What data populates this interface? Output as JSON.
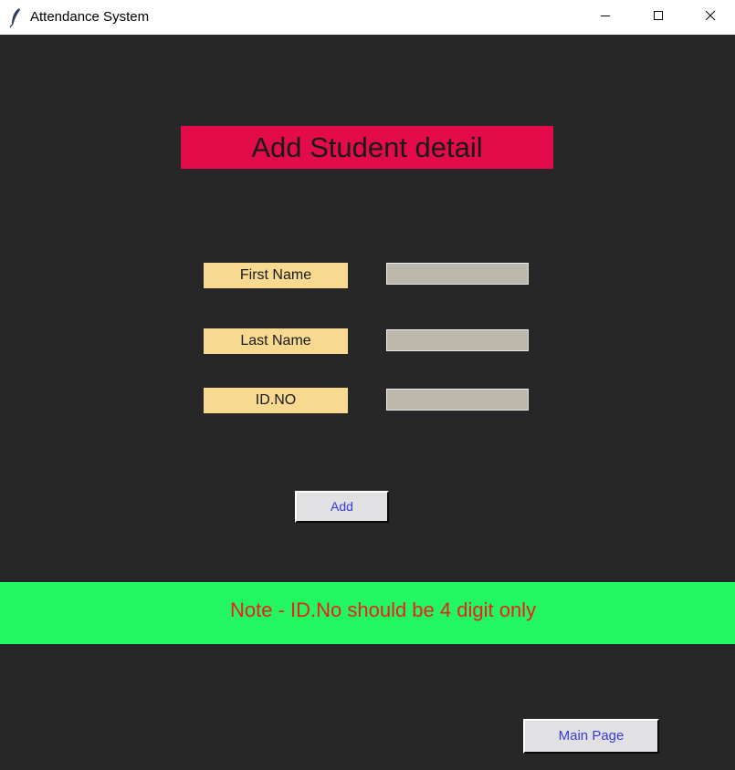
{
  "window": {
    "title": "Attendance System",
    "icons": {
      "app": "feather-icon",
      "minimize": "minimize-icon",
      "maximize": "maximize-icon",
      "close": "close-icon"
    }
  },
  "form": {
    "heading": "Add Student detail",
    "fields": [
      {
        "label": "First Name",
        "value": ""
      },
      {
        "label": "Last Name",
        "value": ""
      },
      {
        "label": "ID.NO",
        "value": ""
      }
    ],
    "add_label": "Add"
  },
  "note": {
    "text": "Note -  ID.No should be 4 digit only"
  },
  "footer": {
    "main_page_label": "Main Page"
  },
  "colors": {
    "background": "#282727",
    "heading_bg": "#e30b4a",
    "label_bg": "#f7d98f",
    "input_bg": "#bdb8ac",
    "note_bg": "#22f760",
    "note_text": "#ee1e1e",
    "button_text": "#3a3ad8"
  }
}
